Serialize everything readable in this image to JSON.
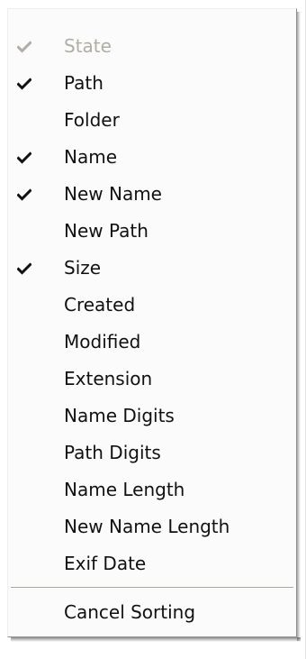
{
  "menu": {
    "items": [
      {
        "label": "State",
        "checked": true,
        "enabled": false
      },
      {
        "label": "Path",
        "checked": true,
        "enabled": true
      },
      {
        "label": "Folder",
        "checked": false,
        "enabled": true
      },
      {
        "label": "Name",
        "checked": true,
        "enabled": true
      },
      {
        "label": "New Name",
        "checked": true,
        "enabled": true
      },
      {
        "label": "New Path",
        "checked": false,
        "enabled": true
      },
      {
        "label": "Size",
        "checked": true,
        "enabled": true
      },
      {
        "label": "Created",
        "checked": false,
        "enabled": true
      },
      {
        "label": "Modified",
        "checked": false,
        "enabled": true
      },
      {
        "label": "Extension",
        "checked": false,
        "enabled": true
      },
      {
        "label": "Name Digits",
        "checked": false,
        "enabled": true
      },
      {
        "label": "Path Digits",
        "checked": false,
        "enabled": true
      },
      {
        "label": "Name Length",
        "checked": false,
        "enabled": true
      },
      {
        "label": "New Name Length",
        "checked": false,
        "enabled": true
      },
      {
        "label": "Exif Date",
        "checked": false,
        "enabled": true
      }
    ],
    "footer_items": [
      {
        "label": "Cancel Sorting",
        "checked": false,
        "enabled": true
      }
    ]
  },
  "colors": {
    "menu_background": "#fbfbfb",
    "text": "#111111",
    "disabled_text": "#b0aea4",
    "separator": "#aca899"
  },
  "icons": {
    "check": "check-icon"
  }
}
